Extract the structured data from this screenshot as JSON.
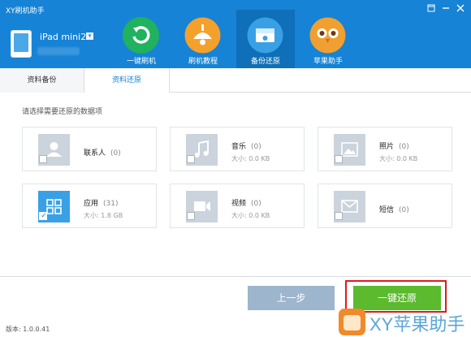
{
  "window": {
    "title": "XY刷机助手",
    "controls": [
      "pin-icon",
      "minimize-icon",
      "close-icon"
    ]
  },
  "device": {
    "name": "iPad mini2"
  },
  "nav": [
    {
      "label": "一键刷机",
      "icon": "refresh-icon",
      "color": "#20b25e"
    },
    {
      "label": "刷机教程",
      "icon": "lamp-icon",
      "color": "#f4a12c"
    },
    {
      "label": "备份还原",
      "icon": "disk-icon",
      "color": "#3aa0e6",
      "active": true
    },
    {
      "label": "苹果助手",
      "icon": "owl-icon",
      "color": "#f0a030"
    }
  ],
  "tabs": [
    {
      "label": "资料备份"
    },
    {
      "label": "资料还原",
      "active": true
    }
  ],
  "prompt": "请选择需要还原的数据项",
  "items": [
    {
      "name": "联系人",
      "count": "(0)",
      "size": "",
      "icon": "contact-icon",
      "checked": false
    },
    {
      "name": "音乐",
      "count": "(0)",
      "size": "大小: 0.0 KB",
      "icon": "music-icon",
      "checked": false
    },
    {
      "name": "照片",
      "count": "(0)",
      "size": "大小: 0.0 KB",
      "icon": "photo-icon",
      "checked": false
    },
    {
      "name": "应用",
      "count": "(31)",
      "size": "大小: 1.8 GB",
      "icon": "apps-icon",
      "checked": true
    },
    {
      "name": "视频",
      "count": "(0)",
      "size": "大小: 0.0 KB",
      "icon": "video-icon",
      "checked": false
    },
    {
      "name": "短信",
      "count": "(0)",
      "size": "",
      "icon": "sms-icon",
      "checked": false
    }
  ],
  "buttons": {
    "prev": "上一步",
    "restore": "一键还原"
  },
  "version": "版本: 1.0.0.41",
  "watermark": "XY苹果助手",
  "colors": {
    "header": "#1683d6",
    "accent": "#1683d6",
    "restore": "#5bba2d",
    "prev": "#9db6cd",
    "highlight": "#e01a1a"
  }
}
